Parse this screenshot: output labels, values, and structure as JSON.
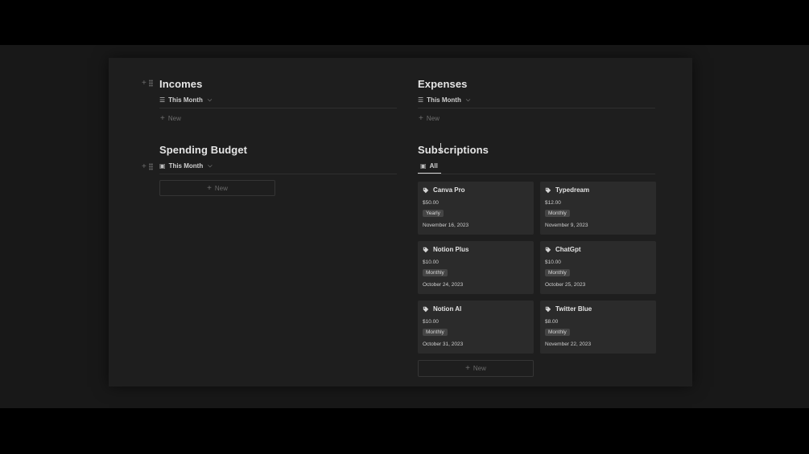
{
  "incomes": {
    "title": "Incomes",
    "view_label": "This Month",
    "new_label": "New"
  },
  "expenses": {
    "title": "Expenses",
    "view_label": "This Month",
    "new_label": "New"
  },
  "spending_budget": {
    "title": "Spending Budget",
    "view_label": "This Month",
    "new_label": "New"
  },
  "subscriptions": {
    "title": "Subscriptions",
    "tab_label": "All",
    "new_label": "New",
    "cards": [
      {
        "name": "Canva Pro",
        "price": "$50.00",
        "cycle": "Yearly",
        "date": "November 16, 2023"
      },
      {
        "name": "Typedream",
        "price": "$12.00",
        "cycle": "Monthly",
        "date": "November 9, 2023"
      },
      {
        "name": "Notion Plus",
        "price": "$10.00",
        "cycle": "Monthly",
        "date": "October 24, 2023"
      },
      {
        "name": "ChatGpt",
        "price": "$10.00",
        "cycle": "Monthly",
        "date": "October 25, 2023"
      },
      {
        "name": "Notion AI",
        "price": "$10.00",
        "cycle": "Monthly",
        "date": "October 31, 2023"
      },
      {
        "name": "Twitter Blue",
        "price": "$8.00",
        "cycle": "Monthly",
        "date": "November 22, 2023"
      }
    ]
  },
  "icons": {
    "add": "plus-icon",
    "drag": "drag-handle-icon",
    "list_view": "list-icon",
    "gallery_view": "gallery-icon",
    "dropdown": "chevron-down-icon",
    "card": "tag-icon"
  },
  "colors": {
    "background": "#1e1e1e",
    "card": "#2b2b2b",
    "badge": "#454545",
    "text": "#e6e6e6"
  }
}
